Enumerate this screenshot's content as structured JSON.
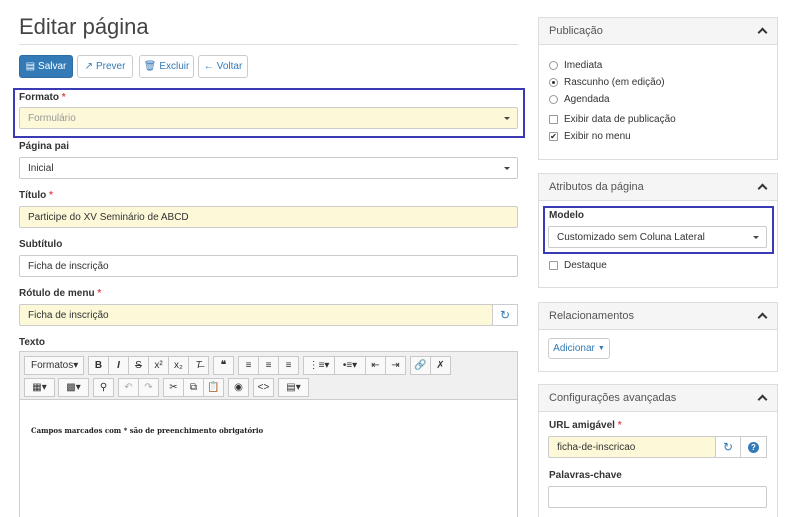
{
  "page": {
    "title": "Editar página"
  },
  "toolbar": {
    "save": "Salvar",
    "preview": "Prever",
    "delete": "Excluir",
    "back": "Voltar"
  },
  "form": {
    "formato": {
      "label": "Formato",
      "required": "*",
      "value": "Formulário"
    },
    "pagina_pai": {
      "label": "Página pai",
      "value": "Inicial"
    },
    "titulo": {
      "label": "Título",
      "required": "*",
      "value": "Participe do XV Seminário de ABCD"
    },
    "subtitulo": {
      "label": "Subtítulo",
      "value": "Ficha de inscrição"
    },
    "rotulo_menu": {
      "label": "Rótulo de menu",
      "required": "*",
      "value": "Ficha de inscrição"
    },
    "texto": {
      "label": "Texto"
    }
  },
  "editor": {
    "formats_label": "Formatos",
    "content": "Campos marcados com * são de preenchimento obrigatório"
  },
  "sidebar": {
    "publicacao": {
      "title": "Publicação",
      "options": [
        "Imediata",
        "Rascunho (em edição)",
        "Agendada"
      ],
      "selected": 1,
      "checkboxes": [
        {
          "label": "Exibir data de publicação",
          "checked": false
        },
        {
          "label": "Exibir no menu",
          "checked": true
        }
      ]
    },
    "atributos": {
      "title": "Atributos da página",
      "modelo_label": "Modelo",
      "modelo_value": "Customizado sem Coluna Lateral",
      "destaque_label": "Destaque"
    },
    "relacionamentos": {
      "title": "Relacionamentos",
      "add_label": "Adicionar"
    },
    "config": {
      "title": "Configurações avançadas",
      "url_label": "URL amigável",
      "url_required": "*",
      "url_value": "ficha-de-inscricao",
      "keywords_label": "Palavras-chave"
    }
  },
  "colors": {
    "primary": "#337ab7",
    "highlight": "#3a3ab5",
    "required_field": "#fcf8d8",
    "required_mark": "#d9534f"
  }
}
